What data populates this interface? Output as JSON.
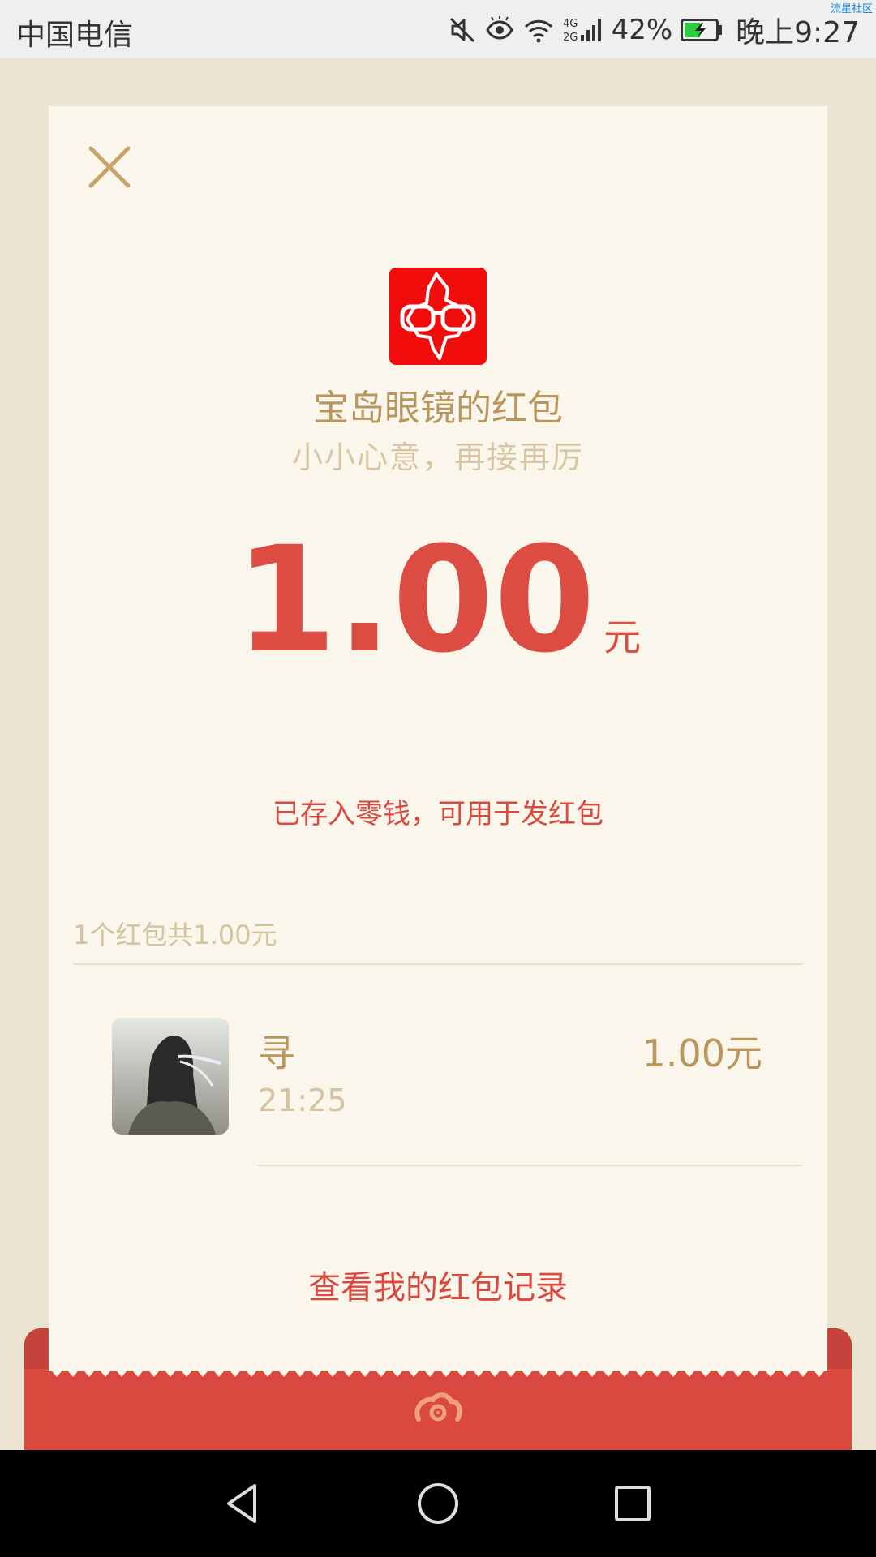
{
  "status_bar": {
    "carrier": "中国电信",
    "battery_percent": "42%",
    "time": "晚上9:27",
    "network_label_top": "4G",
    "network_label_bottom": "2G",
    "watermark": "流星社区",
    "icons": [
      "mute-icon",
      "eye-comfort-icon",
      "wifi-icon",
      "signal-icon",
      "battery-charging-icon"
    ],
    "colors": {
      "battery_fill": "#2ecc40",
      "watermark": "#1e88e5"
    }
  },
  "red_packet": {
    "sender_title": "宝岛眼镜的红包",
    "greeting": "小小心意，再接再厉",
    "amount": "1.00",
    "amount_unit": "元",
    "saved_note": "已存入零钱，可用于发红包",
    "summary": "1个红包共1.00元",
    "records": [
      {
        "name": "寻",
        "time": "21:25",
        "amount": "1.00元"
      }
    ],
    "history_link": "查看我的红包记录",
    "close_icon": "close-icon",
    "logo_icon": "brand-logo-icon"
  },
  "nav_bar": {
    "buttons": [
      "back-icon",
      "home-icon",
      "recents-icon"
    ]
  },
  "colors": {
    "page_background": "#ece3d0",
    "card_background": "#faf6ec",
    "accent_red": "#dc4c43",
    "gold_text": "#b9965d",
    "light_gold_text": "#d5c29e",
    "logo_red": "#f20d0d"
  }
}
